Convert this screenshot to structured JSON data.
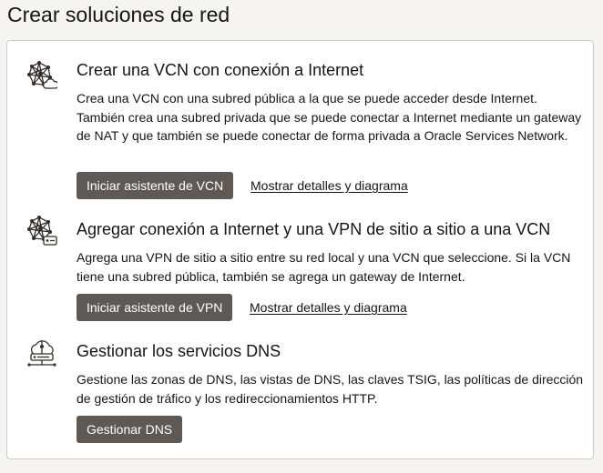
{
  "page": {
    "title": "Crear soluciones de red"
  },
  "sections": [
    {
      "icon": "network-globe-cloud-icon",
      "title": "Crear una VCN con conexión a Internet",
      "description": "Crea una VCN con una subred pública a la que se puede acceder desde Internet. También crea una subred privada que se puede conectar a Internet mediante un gateway de NAT y que también se puede conectar de forma privada a Oracle Services Network.",
      "button_label": "Iniciar asistente de VCN",
      "link_label": "Mostrar detalles y diagrama"
    },
    {
      "icon": "network-globe-lock-icon",
      "title": "Agregar conexión a Internet y una VPN de sitio a sitio a una VCN",
      "description": "Agrega una VPN de sitio a sitio entre su red local y una VCN que seleccione. Si la VCN tiene una subred pública, también se agrega un gateway de Internet.",
      "button_label": "Iniciar asistente de VPN",
      "link_label": "Mostrar detalles y diagrama"
    },
    {
      "icon": "dns-cloud-icon",
      "title": "Gestionar los servicios DNS",
      "description": "Gestione las zonas de DNS, las vistas de DNS, las claves TSIG, las políticas de dirección de gestión de tráfico y los redireccionamientos HTTP.",
      "button_label": "Gestionar DNS"
    }
  ],
  "colors": {
    "page_background": "#f6f4f1",
    "card_background": "#ffffff",
    "card_border": "#cfcbc6",
    "button_background": "#5f5955",
    "button_text": "#ffffff",
    "text": "#161513",
    "icon_stroke": "#312d2a"
  }
}
